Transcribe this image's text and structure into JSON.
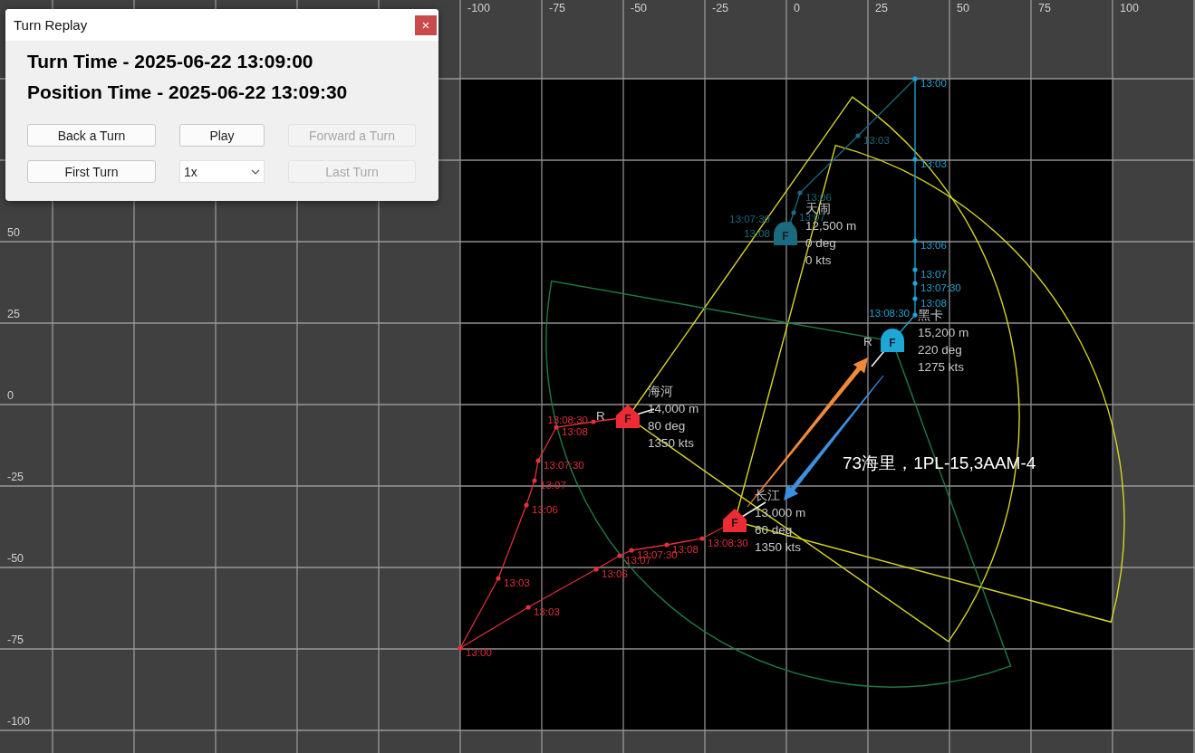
{
  "dialog": {
    "title": "Turn Replay",
    "close": "×",
    "turn_time": "Turn Time - 2025-06-22 13:09:00",
    "position_time": "Position Time - 2025-06-22 13:09:30",
    "controls": [
      {
        "kind": "button",
        "label": "Back a Turn",
        "disabled": false
      },
      {
        "kind": "button",
        "label": "Play",
        "disabled": false
      },
      {
        "kind": "button",
        "label": "Forward a Turn",
        "disabled": true
      },
      {
        "kind": "button",
        "label": "First Turn",
        "disabled": false
      },
      {
        "kind": "select",
        "value": "1x"
      },
      {
        "kind": "button",
        "label": "Last Turn",
        "disabled": true
      }
    ]
  },
  "plot": {
    "top_axis": [
      "-100",
      "-75",
      "-50",
      "-25",
      "0",
      "25",
      "50",
      "75",
      "100"
    ],
    "left_axis": [
      "50",
      "25",
      "0",
      "-25",
      "-50",
      "-75",
      "-100"
    ],
    "tracks": [
      {
        "color": "#1b6a80",
        "times": [
          "13:03",
          "13:06",
          "13:07",
          "13:07:30",
          "13:08"
        ]
      },
      {
        "color": "#1ea6d6",
        "times": [
          "13:00",
          "13:03",
          "13:06",
          "13:07",
          "13:07:30",
          "13:08",
          "13:08:30"
        ]
      },
      {
        "color": "#e0303a",
        "times": [
          "13:08:30",
          "13:08",
          "13:07:30",
          "13:07",
          "13:06",
          "13:03"
        ]
      },
      {
        "color": "#e0303a",
        "times": [
          "13:00",
          "13:03",
          "13:06",
          "13:07",
          "13:07:30",
          "13:08",
          "13:08:30"
        ]
      }
    ],
    "aircraft": [
      {
        "name": "天闹",
        "lines": [
          "12,500 m",
          "0 deg",
          "0 kts"
        ],
        "kind": "dome",
        "letter": "F",
        "color": "#1b6a80"
      },
      {
        "name": "黑卡",
        "lines": [
          "15,200 m",
          "220 deg",
          "1275 kts"
        ],
        "kind": "dome",
        "letter": "F",
        "color": "#1ea6d6"
      },
      {
        "name": "海河",
        "lines": [
          "14,000 m",
          "80 deg",
          "1350 kts"
        ],
        "kind": "house",
        "letter": "F",
        "color": "#ee2a35"
      },
      {
        "name": "长江",
        "lines": [
          "13,000 m",
          "60 deg",
          "1350 kts"
        ],
        "kind": "house",
        "letter": "F",
        "color": "#ee2a35"
      }
    ],
    "radar_sectors": [
      {
        "color": "#d6d622"
      },
      {
        "color": "#d6d622"
      },
      {
        "color": "#1f7a45"
      }
    ],
    "arrows": [
      {
        "color": "#f08a3a"
      },
      {
        "color": "#3d8fe0"
      }
    ],
    "radar_labels": [
      "R",
      "R"
    ],
    "note": "73海里，1PL-15,3AAM-4"
  }
}
